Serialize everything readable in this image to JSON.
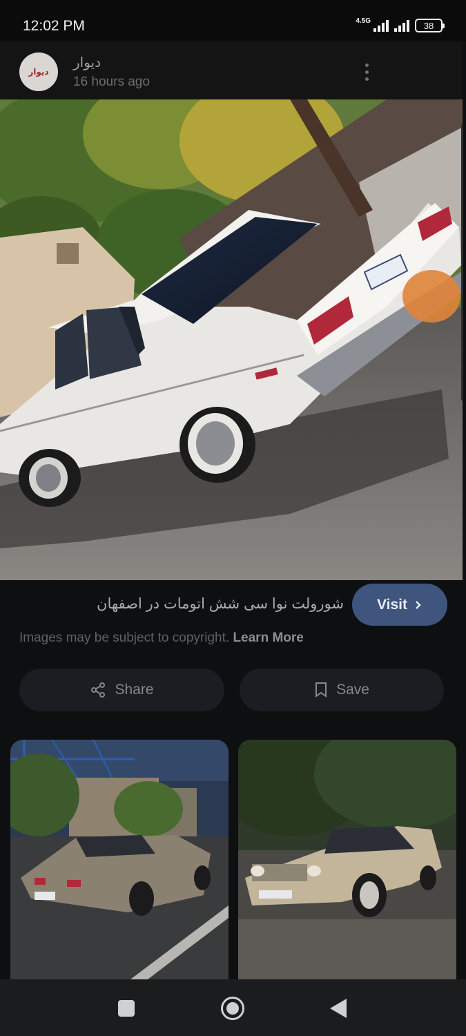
{
  "status_bar": {
    "time": "12:02 PM",
    "network": "4.5G",
    "battery": "38"
  },
  "header": {
    "avatar_text": "دیوار",
    "site_name": "دیوار",
    "time_ago": "16 hours ago",
    "menu_icon": "more-vert-icon"
  },
  "main_image": {
    "subject": "white-sedan-photo"
  },
  "caption": {
    "title": "شورولت نوا سی شش اتومات در اصفهان",
    "visit_label": "Visit",
    "copyright_text": "Images may be subject to copyright.",
    "learn_more": "Learn More"
  },
  "actions": {
    "share_label": "Share",
    "save_label": "Save"
  },
  "related": {
    "items": [
      {
        "subject": "tan-sedan-rear-photo"
      },
      {
        "subject": "tan-sedan-front-photo"
      }
    ]
  },
  "nav_bar": {
    "icons": [
      "recents-icon",
      "home-icon",
      "back-icon"
    ]
  },
  "colors": {
    "background": "#0e0f11",
    "visit_button": "#3f557d",
    "action_button": "#1a1d22"
  }
}
